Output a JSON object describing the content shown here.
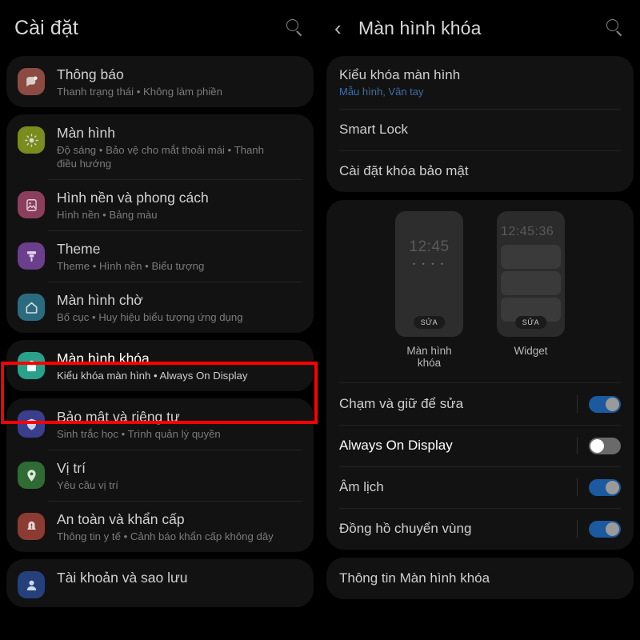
{
  "left": {
    "header": {
      "title": "Cài đặt",
      "search_icon": "search-icon"
    },
    "groups": [
      {
        "items": [
          {
            "title": "Thông báo",
            "subtitle": "Thanh trạng thái  •  Không làm phiền",
            "icon": "notification-icon",
            "color": "#8c4b42"
          }
        ]
      },
      {
        "items": [
          {
            "title": "Màn hình",
            "subtitle": "Độ sáng  •  Bảo vệ cho mắt thoải mái  •  Thanh điều hướng",
            "icon": "brightness-icon",
            "color": "#7a8c1e"
          },
          {
            "title": "Hình nền và phong cách",
            "subtitle": "Hình nền  •  Bảng màu",
            "icon": "wallpaper-icon",
            "color": "#8c3f5c"
          },
          {
            "title": "Theme",
            "subtitle": "Theme  •  Hình nền  •  Biểu tượng",
            "icon": "theme-brush-icon",
            "color": "#6b3f8c"
          },
          {
            "title": "Màn hình chờ",
            "subtitle": "Bố cục  •  Huy hiệu biểu tượng ứng dụng",
            "icon": "home-icon",
            "color": "#2b6b80"
          }
        ]
      },
      {
        "highlight": true,
        "items": [
          {
            "title": "Màn hình khóa",
            "subtitle": "Kiểu khóa màn hình  •  Always On Display",
            "icon": "lock-icon",
            "color": "#2aa18a"
          }
        ]
      },
      {
        "items": [
          {
            "title": "Bảo mật và riêng tư",
            "subtitle": "Sinh trắc học  •  Trình quản lý quyền",
            "icon": "shield-icon",
            "color": "#3a3f8c"
          },
          {
            "title": "Vị trí",
            "subtitle": "Yêu cầu vị trí",
            "icon": "location-pin-icon",
            "color": "#2f6b33"
          },
          {
            "title": "An toàn và khẩn cấp",
            "subtitle": "Thông tin y tế  •  Cảnh báo khẩn cấp không dây",
            "icon": "emergency-icon",
            "color": "#8c3b33"
          }
        ]
      },
      {
        "items": [
          {
            "title": "Tài khoản và sao lưu",
            "subtitle": "",
            "icon": "account-icon",
            "color": "#25407a"
          }
        ]
      }
    ]
  },
  "right": {
    "header": {
      "back_icon": "chevron-left-icon",
      "title": "Màn hình khóa",
      "search_icon": "search-icon"
    },
    "lock_group": [
      {
        "title": "Kiểu khóa màn hình",
        "subtitle": "Mẫu hình, Vân tay"
      },
      {
        "title": "Smart Lock",
        "subtitle": ""
      },
      {
        "title": "Cài đặt khóa bảo mật",
        "subtitle": ""
      }
    ],
    "previews": [
      {
        "label": "Màn hình khóa",
        "clock": "12:45",
        "dots": "• • • •",
        "edit_label": "SỬA",
        "type": "lockscreen"
      },
      {
        "label": "Widget",
        "clock": "12:45:36",
        "edit_label": "SỬA",
        "type": "widget"
      }
    ],
    "toggles": [
      {
        "label": "Chạm và giữ để sửa",
        "state": "on"
      },
      {
        "label": "Always On Display",
        "state": "off",
        "highlight": true
      },
      {
        "label": "Âm lịch",
        "state": "on"
      },
      {
        "label": "Đồng hồ chuyển vùng",
        "state": "on"
      }
    ],
    "info_group": [
      {
        "title": "Thông tin Màn hình khóa",
        "subtitle": ""
      }
    ]
  },
  "annotations": {
    "color": "#ff0000",
    "boxes": [
      {
        "name": "highlight-lock-screen-row"
      },
      {
        "name": "highlight-always-on-display-row"
      }
    ]
  }
}
